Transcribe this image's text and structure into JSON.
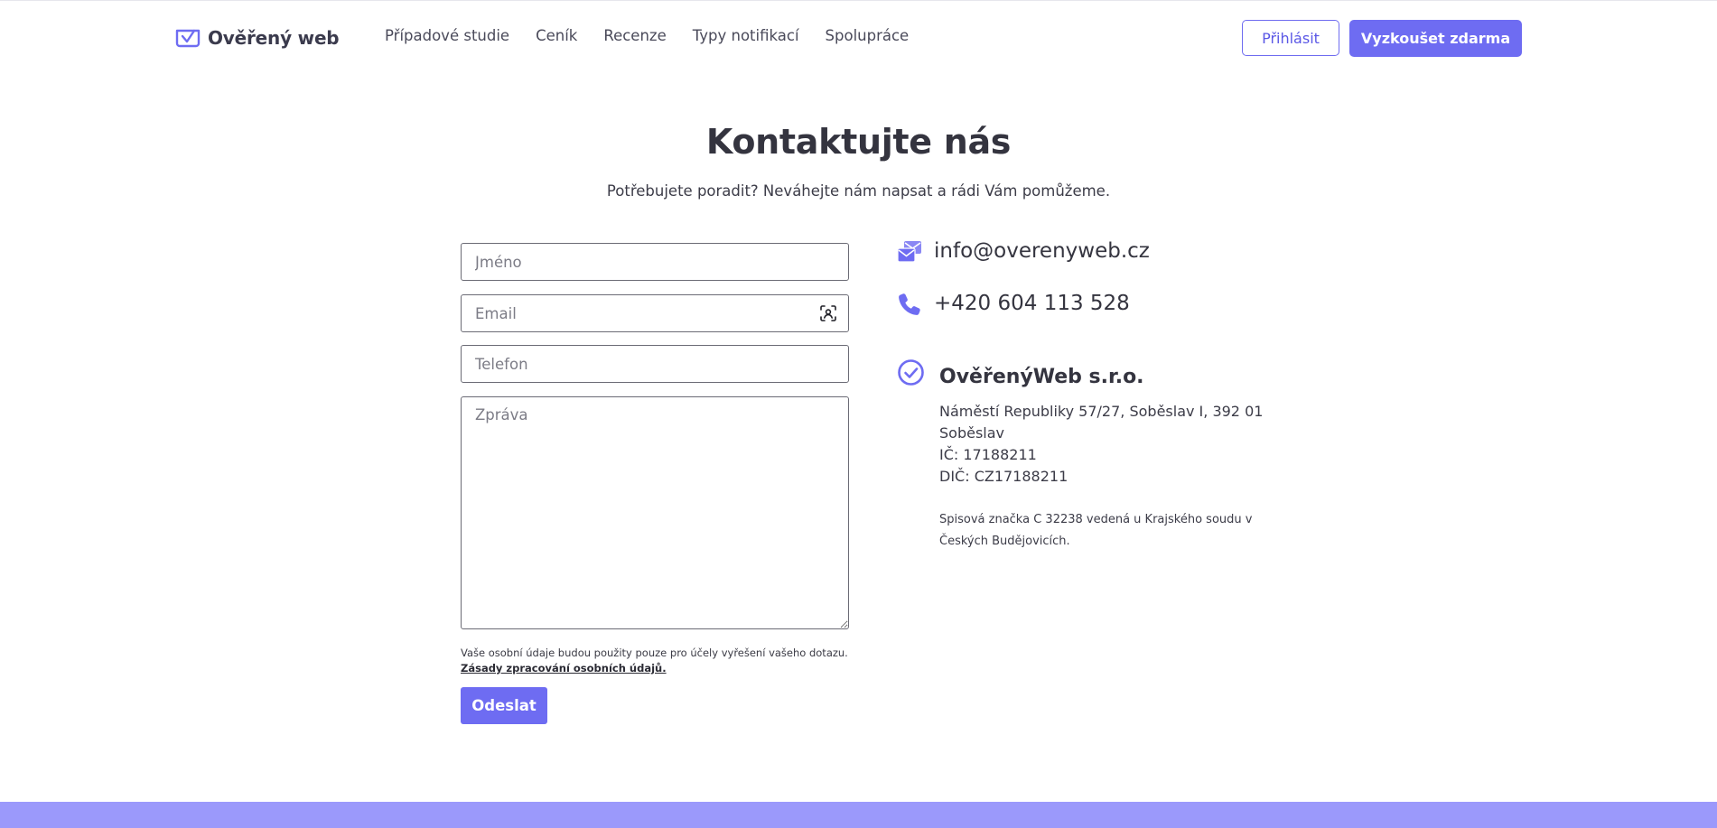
{
  "brand": {
    "name": "Ověřený web",
    "accent": "#6e6cf2",
    "footer_color": "#9b99fb"
  },
  "nav": {
    "items": [
      "Případové studie",
      "Ceník",
      "Recenze",
      "Typy notifikací",
      "Spolupráce"
    ]
  },
  "header": {
    "login_label": "Přihlásit",
    "trial_label": "Vyzkoušet zdarma"
  },
  "main": {
    "title": "Kontaktujte nás",
    "subtitle": "Potřebujete poradit? Neváhejte nám napsat a rádi Vám pomůžeme."
  },
  "form": {
    "name_placeholder": "Jméno",
    "email_placeholder": "Email",
    "phone_placeholder": "Telefon",
    "message_placeholder": "Zpráva",
    "privacy_text": "Vaše osobní údaje budou použity pouze pro účely vyřešení vašeho dotazu.",
    "privacy_link": "Zásady zpracování osobních údajů.",
    "submit_label": "Odeslat"
  },
  "contact": {
    "email": "info@overenyweb.cz",
    "phone": "+420 604 113 528",
    "icons": [
      "mail-icon",
      "phone-icon",
      "check-circle-icon",
      "autofill-contact-icon"
    ]
  },
  "company": {
    "name": "OvěřenýWeb s.r.o.",
    "address": "Náměstí Republiky 57/27, Soběslav I, 392 01 Soběslav",
    "ic": "IČ: 17188211",
    "dic": "DIČ: CZ17188211",
    "registry": "Spisová značka C 32238 vedená u Krajského soudu v Českých Budějovicích."
  }
}
